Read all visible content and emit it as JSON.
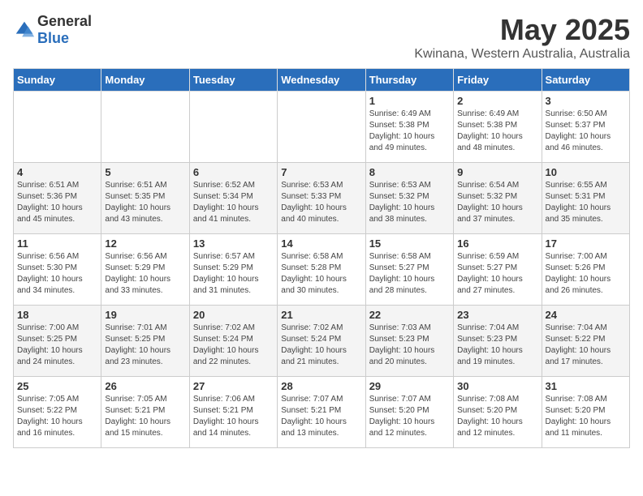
{
  "header": {
    "logo_general": "General",
    "logo_blue": "Blue",
    "month": "May 2025",
    "location": "Kwinana, Western Australia, Australia"
  },
  "weekdays": [
    "Sunday",
    "Monday",
    "Tuesday",
    "Wednesday",
    "Thursday",
    "Friday",
    "Saturday"
  ],
  "weeks": [
    [
      {
        "day": "",
        "info": ""
      },
      {
        "day": "",
        "info": ""
      },
      {
        "day": "",
        "info": ""
      },
      {
        "day": "",
        "info": ""
      },
      {
        "day": "1",
        "info": "Sunrise: 6:49 AM\nSunset: 5:38 PM\nDaylight: 10 hours\nand 49 minutes."
      },
      {
        "day": "2",
        "info": "Sunrise: 6:49 AM\nSunset: 5:38 PM\nDaylight: 10 hours\nand 48 minutes."
      },
      {
        "day": "3",
        "info": "Sunrise: 6:50 AM\nSunset: 5:37 PM\nDaylight: 10 hours\nand 46 minutes."
      }
    ],
    [
      {
        "day": "4",
        "info": "Sunrise: 6:51 AM\nSunset: 5:36 PM\nDaylight: 10 hours\nand 45 minutes."
      },
      {
        "day": "5",
        "info": "Sunrise: 6:51 AM\nSunset: 5:35 PM\nDaylight: 10 hours\nand 43 minutes."
      },
      {
        "day": "6",
        "info": "Sunrise: 6:52 AM\nSunset: 5:34 PM\nDaylight: 10 hours\nand 41 minutes."
      },
      {
        "day": "7",
        "info": "Sunrise: 6:53 AM\nSunset: 5:33 PM\nDaylight: 10 hours\nand 40 minutes."
      },
      {
        "day": "8",
        "info": "Sunrise: 6:53 AM\nSunset: 5:32 PM\nDaylight: 10 hours\nand 38 minutes."
      },
      {
        "day": "9",
        "info": "Sunrise: 6:54 AM\nSunset: 5:32 PM\nDaylight: 10 hours\nand 37 minutes."
      },
      {
        "day": "10",
        "info": "Sunrise: 6:55 AM\nSunset: 5:31 PM\nDaylight: 10 hours\nand 35 minutes."
      }
    ],
    [
      {
        "day": "11",
        "info": "Sunrise: 6:56 AM\nSunset: 5:30 PM\nDaylight: 10 hours\nand 34 minutes."
      },
      {
        "day": "12",
        "info": "Sunrise: 6:56 AM\nSunset: 5:29 PM\nDaylight: 10 hours\nand 33 minutes."
      },
      {
        "day": "13",
        "info": "Sunrise: 6:57 AM\nSunset: 5:29 PM\nDaylight: 10 hours\nand 31 minutes."
      },
      {
        "day": "14",
        "info": "Sunrise: 6:58 AM\nSunset: 5:28 PM\nDaylight: 10 hours\nand 30 minutes."
      },
      {
        "day": "15",
        "info": "Sunrise: 6:58 AM\nSunset: 5:27 PM\nDaylight: 10 hours\nand 28 minutes."
      },
      {
        "day": "16",
        "info": "Sunrise: 6:59 AM\nSunset: 5:27 PM\nDaylight: 10 hours\nand 27 minutes."
      },
      {
        "day": "17",
        "info": "Sunrise: 7:00 AM\nSunset: 5:26 PM\nDaylight: 10 hours\nand 26 minutes."
      }
    ],
    [
      {
        "day": "18",
        "info": "Sunrise: 7:00 AM\nSunset: 5:25 PM\nDaylight: 10 hours\nand 24 minutes."
      },
      {
        "day": "19",
        "info": "Sunrise: 7:01 AM\nSunset: 5:25 PM\nDaylight: 10 hours\nand 23 minutes."
      },
      {
        "day": "20",
        "info": "Sunrise: 7:02 AM\nSunset: 5:24 PM\nDaylight: 10 hours\nand 22 minutes."
      },
      {
        "day": "21",
        "info": "Sunrise: 7:02 AM\nSunset: 5:24 PM\nDaylight: 10 hours\nand 21 minutes."
      },
      {
        "day": "22",
        "info": "Sunrise: 7:03 AM\nSunset: 5:23 PM\nDaylight: 10 hours\nand 20 minutes."
      },
      {
        "day": "23",
        "info": "Sunrise: 7:04 AM\nSunset: 5:23 PM\nDaylight: 10 hours\nand 19 minutes."
      },
      {
        "day": "24",
        "info": "Sunrise: 7:04 AM\nSunset: 5:22 PM\nDaylight: 10 hours\nand 17 minutes."
      }
    ],
    [
      {
        "day": "25",
        "info": "Sunrise: 7:05 AM\nSunset: 5:22 PM\nDaylight: 10 hours\nand 16 minutes."
      },
      {
        "day": "26",
        "info": "Sunrise: 7:05 AM\nSunset: 5:21 PM\nDaylight: 10 hours\nand 15 minutes."
      },
      {
        "day": "27",
        "info": "Sunrise: 7:06 AM\nSunset: 5:21 PM\nDaylight: 10 hours\nand 14 minutes."
      },
      {
        "day": "28",
        "info": "Sunrise: 7:07 AM\nSunset: 5:21 PM\nDaylight: 10 hours\nand 13 minutes."
      },
      {
        "day": "29",
        "info": "Sunrise: 7:07 AM\nSunset: 5:20 PM\nDaylight: 10 hours\nand 12 minutes."
      },
      {
        "day": "30",
        "info": "Sunrise: 7:08 AM\nSunset: 5:20 PM\nDaylight: 10 hours\nand 12 minutes."
      },
      {
        "day": "31",
        "info": "Sunrise: 7:08 AM\nSunset: 5:20 PM\nDaylight: 10 hours\nand 11 minutes."
      }
    ]
  ]
}
